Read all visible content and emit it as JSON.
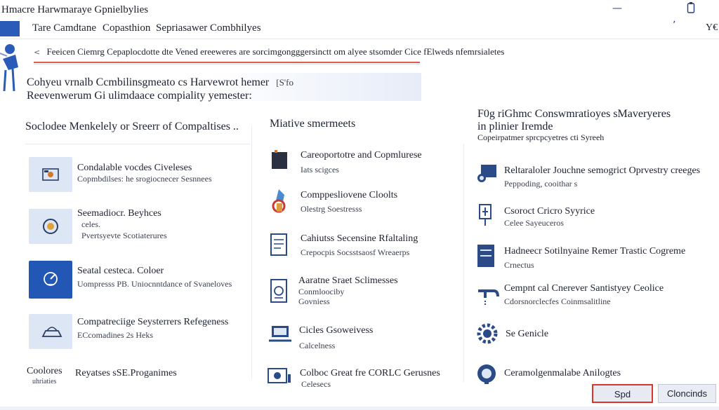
{
  "window": {
    "title": "Hmacre Harwmaraye Gpnielbylies",
    "minimize_icon": "minimize-icon",
    "phone_icon": "device-icon"
  },
  "tabs": [
    {
      "label": "Tare Camdtane"
    },
    {
      "label": "Copasthion"
    },
    {
      "label": "Sepriasawer Combhilyes"
    }
  ],
  "tabbar_right": {
    "caret": "ʏ",
    "label": "Y€"
  },
  "banner": {
    "text": "Feeicen Ciemrg Cepaplocdotte dte Vened ereeweres are sorcimgongggersinctt om alyee stsomder Cice fElweds nfemrsialetes"
  },
  "header": {
    "title": "Cohyeu vrnalb Ccmbilinsgmeato cs Harvewrot hemer",
    "badge": "[S'fo",
    "subtitle": "Reevenwerum Gi ulimdaace compiality yemester:"
  },
  "columns": [
    {
      "title": "Soclodee Menkelely or Sreerr of Compaltises ..",
      "items": [
        {
          "title": "Condalable vocdes Civeleses",
          "subtitle": "Copmbdilses: he srogiocnecer Sesnnees",
          "icon": "webcam-icon",
          "style": "light"
        },
        {
          "title": "Seemadiocr. Beyhces",
          "subtitle": "celes.",
          "extra": "Pvertsyevte Scotiaterures",
          "icon": "speaker-icon",
          "style": "light"
        },
        {
          "title": "Seatal cesteca. Coloer",
          "subtitle": "Uompresss PB. Uniocnntdance of Svaneloves",
          "icon": "gauge-icon",
          "style": "dark"
        },
        {
          "title": "Compatreciige Seysterrers Refegeness",
          "subtitle": "ECcomadines 2s Heks",
          "icon": "scanner-icon",
          "style": "light"
        }
      ]
    },
    {
      "title": "Miative smermeets",
      "items": [
        {
          "title": "Careoportotre and Copmlurese",
          "subtitle": "Iats scigces",
          "icon": "tower-icon"
        },
        {
          "title": "Comppesliovene Cloolts",
          "subtitle": "Olestrg Soestresss",
          "icon": "hand-icon"
        },
        {
          "title": "Cahiutss Secensine Rfaltaling",
          "subtitle": "Crepocpis Socsstsaosf Wreaerps",
          "icon": "document-icon"
        },
        {
          "title": "Aaratne Sraet Sclimesses",
          "subtitle": "Conmloociby",
          "extra": "Govniess",
          "icon": "device-panel-icon"
        },
        {
          "title": "Cicles Gsoweivess",
          "subtitle": "Calcelness",
          "icon": "laptop-icon"
        },
        {
          "title": "Colboc Great fre CORLC Gerusnes",
          "subtitle": "Celesecs",
          "icon": "dashboard-icon"
        }
      ]
    },
    {
      "title": "F0g riGhmc Conswmratioyes sMaveryeres",
      "title2": "in plinier Iremde",
      "title3": "Copeirpatmer sprcpcyetres cti Syreeh",
      "items": [
        {
          "title": "Reltaraloler Jouchne semogrict Oprvestry creeges",
          "subtitle": "Peppoding, cooithar s",
          "icon": "gpu-icon"
        },
        {
          "title": "Csoroct Cricro Syyrice",
          "subtitle": "Celee Sayeuceros",
          "icon": "lab-icon"
        },
        {
          "title": "Hadneecr Sotilnyaine Remer Trastic Cogreme",
          "subtitle": "Crnectus",
          "icon": "server-icon"
        },
        {
          "title": "Cempnt cal Cnerever Santistyey Ceolice",
          "subtitle": "Cdorsnorclecfes Coinmsalitline",
          "icon": "faucet-icon"
        },
        {
          "title": "Se Genicle",
          "subtitle": "",
          "icon": "cog-icon"
        },
        {
          "title": "Ceramolgenmalabe Anilogtes",
          "subtitle": "",
          "icon": "robot-icon"
        }
      ]
    }
  ],
  "footer": {
    "left_title": "Coolores",
    "left_sub": "uhriaties",
    "primary_button": "Spd",
    "secondary_button": "Cloncinds",
    "col1_footer": "Reyatses sSE.Proganimes"
  },
  "colors": {
    "accent": "#2357b5",
    "red_accent": "#d9352d",
    "light_tile": "#dde6f5"
  }
}
